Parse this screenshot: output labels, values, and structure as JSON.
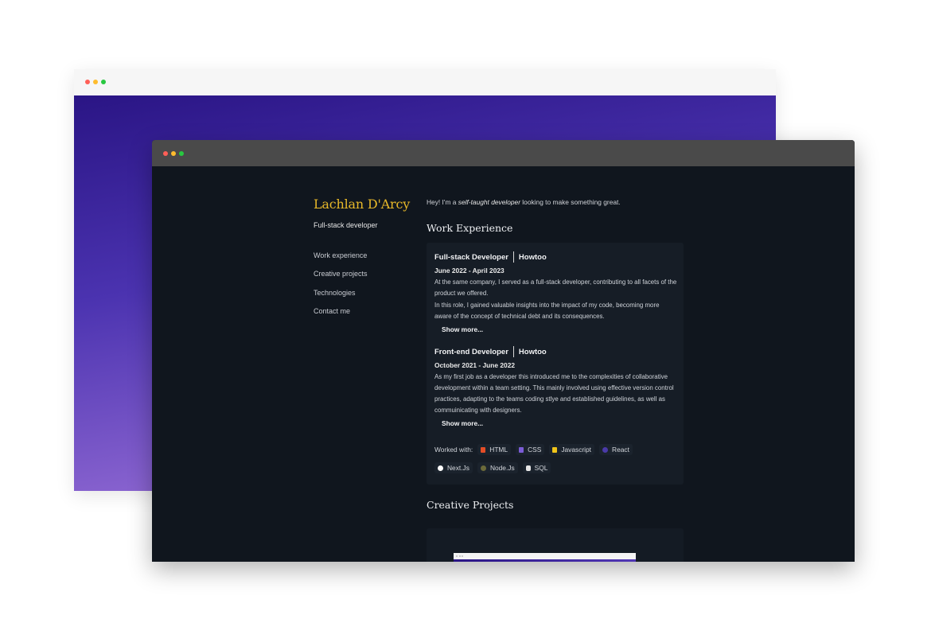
{
  "profile": {
    "name": "Lachlan D'Arcy",
    "role": "Full-stack developer",
    "intro_prefix": "Hey! I'm a ",
    "intro_emphasis": "self-taught developer",
    "intro_suffix": " looking to make something great."
  },
  "nav": {
    "items": [
      {
        "label": "Work experience"
      },
      {
        "label": "Creative projects"
      },
      {
        "label": "Technologies"
      },
      {
        "label": "Contact me"
      }
    ]
  },
  "work": {
    "title": "Work Experience",
    "jobs": [
      {
        "position": "Full-stack Developer",
        "company": "Howtoo",
        "dates": "June 2022 - April 2023",
        "paragraphs": [
          "At the same company, I served as a full-stack developer, contributing to all facets of the product we offered.",
          "In this role, I gained valuable insights into the impact of my code, becoming more aware of the concept of technical debt and its consequences."
        ],
        "show_more": "Show more..."
      },
      {
        "position": "Front-end Developer",
        "company": "Howtoo",
        "dates": "October 2021 - June 2022",
        "paragraphs": [
          "As my first job as a developer this introduced me to the complexities of collaborative development within a team setting. This mainly involved using effective version control practices, adapting to the teams coding stlye and established guidelines, as well as commuinicating with designers."
        ],
        "show_more": "Show more..."
      }
    ],
    "worked_with_label": "Worked with:",
    "technologies": [
      {
        "label": "HTML",
        "icon": "html5-icon",
        "color": "#e44d26"
      },
      {
        "label": "CSS",
        "icon": "css3-icon",
        "color": "#7b5cd6"
      },
      {
        "label": "Javascript",
        "icon": "javascript-icon",
        "color": "#f0c419"
      },
      {
        "label": "React",
        "icon": "react-icon",
        "color": "#4a3aa8"
      },
      {
        "label": "Next.Js",
        "icon": "nextjs-icon",
        "color": "#ffffff"
      },
      {
        "label": "Node.Js",
        "icon": "nodejs-icon",
        "color": "#6b6a3a"
      },
      {
        "label": "SQL",
        "icon": "database-icon",
        "color": "#e6e6e6"
      }
    ]
  },
  "projects": {
    "title": "Creative Projects"
  },
  "colors": {
    "accent": "#e7b829",
    "background": "#10161e",
    "card": "#161d26"
  }
}
